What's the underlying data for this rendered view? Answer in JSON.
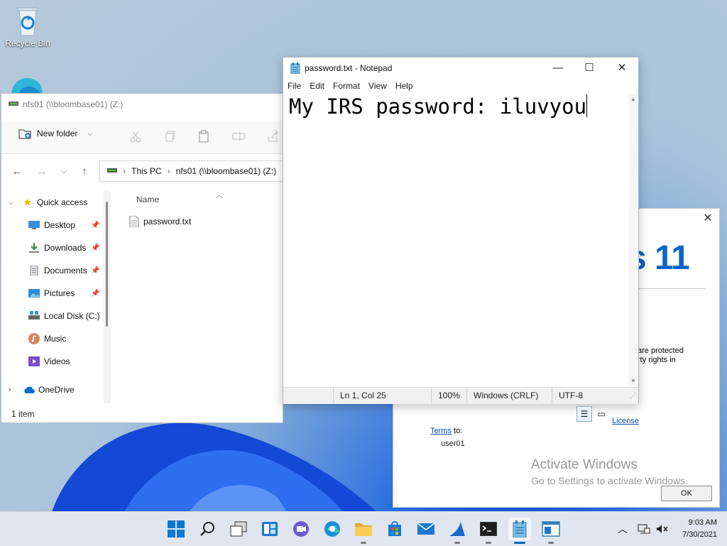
{
  "desktop": {
    "recycle_bin_label": "Recycle Bin"
  },
  "explorer": {
    "title": "nfs01 (\\\\bloombase01) (Z:)",
    "new_folder_label": "New folder",
    "breadcrumb": [
      "This PC",
      "nfs01 (\\\\bloombase01) (Z:)"
    ],
    "sidebar": [
      {
        "label": "Quick access",
        "icon": "star-icon"
      },
      {
        "label": "Desktop",
        "icon": "desktop-icon",
        "pinned": true
      },
      {
        "label": "Downloads",
        "icon": "download-icon",
        "pinned": true
      },
      {
        "label": "Documents",
        "icon": "documents-icon",
        "pinned": true
      },
      {
        "label": "Pictures",
        "icon": "pictures-icon",
        "pinned": true
      },
      {
        "label": "Local Disk (C:)",
        "icon": "drive-icon"
      },
      {
        "label": "Music",
        "icon": "music-icon"
      },
      {
        "label": "Videos",
        "icon": "videos-icon"
      },
      {
        "label": "OneDrive",
        "icon": "cloud-icon"
      }
    ],
    "column_name": "Name",
    "files": [
      {
        "name": "password.txt"
      }
    ],
    "status": "1 item"
  },
  "notepad": {
    "title": "password.txt - Notepad",
    "menu": [
      "File",
      "Edit",
      "Format",
      "View",
      "Help"
    ],
    "content": "My IRS password: iluvyou",
    "status": {
      "position": "Ln 1, Col 25",
      "zoom": "100%",
      "line_ending": "Windows (CRLF)",
      "encoding": "UTF-8"
    }
  },
  "about_dialog": {
    "brand_fragment": "s 11",
    "text_fragment_1": "are protected",
    "text_fragment_2": "rty rights in",
    "license_link_1": "License",
    "license_link_2": "Terms",
    "license_suffix": " to:",
    "licensed_user": "user01",
    "ok_label": "OK"
  },
  "activation": {
    "line1": "Activate Windows",
    "line2": "Go to Settings to activate Windows."
  },
  "taskbar": {
    "time": "9:03 AM",
    "date": "7/30/2021"
  },
  "colors": {
    "accent": "#0067c0",
    "folder_yellow": "#f2c24a",
    "windows_blue": "#0a66c8"
  }
}
